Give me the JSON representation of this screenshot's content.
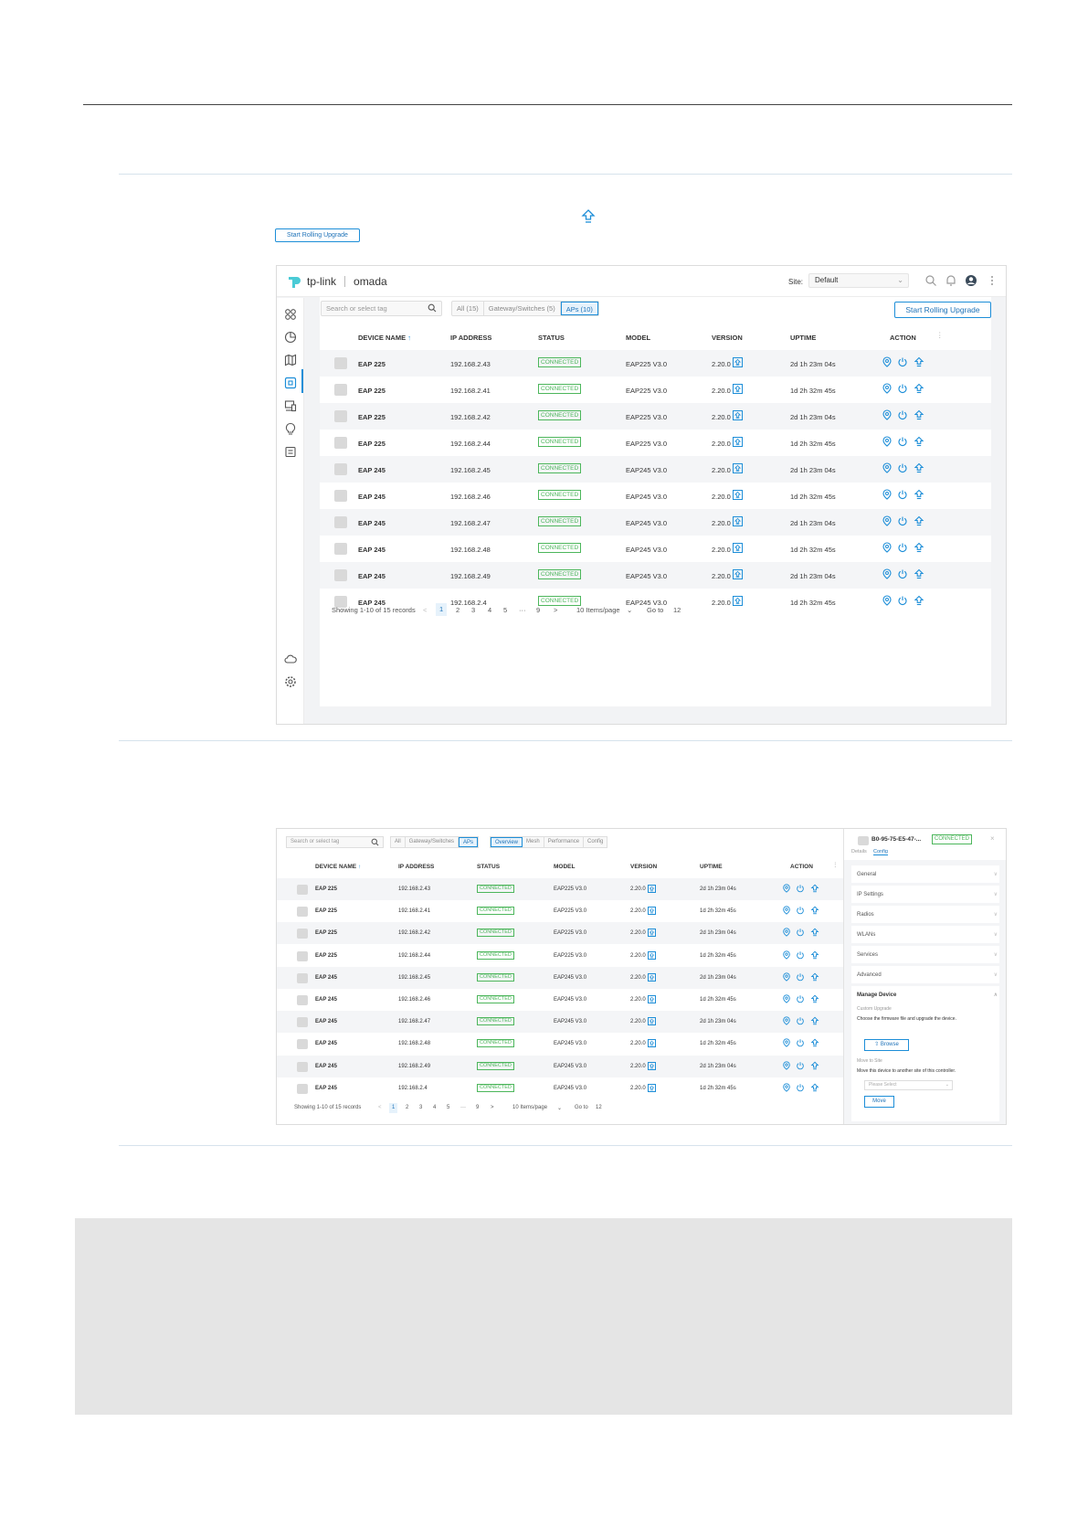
{
  "doc": {
    "button_label": "Start Rolling Upgrade"
  },
  "shot1": {
    "brand": "tp-link",
    "product": "omada",
    "site_label": "Site:",
    "site_value": "Default",
    "search_placeholder": "Search or select tag",
    "tabs": [
      "All (15)",
      "Gateway/Switches (5)",
      "APs (10)"
    ],
    "active_tab": "APs (10)",
    "rolling_button": "Start Rolling Upgrade",
    "columns": [
      "DEVICE NAME",
      "IP ADDRESS",
      "STATUS",
      "MODEL",
      "VERSION",
      "UPTIME",
      "ACTION"
    ],
    "sort_indicator": "↑",
    "rows": [
      {
        "name": "EAP 225",
        "ip": "192.168.2.43",
        "status": "CONNECTED",
        "model": "EAP225 V3.0",
        "version": "2.20.0",
        "uptime": "2d 1h 23m 04s"
      },
      {
        "name": "EAP 225",
        "ip": "192.168.2.41",
        "status": "CONNECTED",
        "model": "EAP225 V3.0",
        "version": "2.20.0",
        "uptime": "1d 2h 32m 45s"
      },
      {
        "name": "EAP 225",
        "ip": "192.168.2.42",
        "status": "CONNECTED",
        "model": "EAP225 V3.0",
        "version": "2.20.0",
        "uptime": "2d 1h 23m 04s"
      },
      {
        "name": "EAP 225",
        "ip": "192.168.2.44",
        "status": "CONNECTED",
        "model": "EAP225 V3.0",
        "version": "2.20.0",
        "uptime": "1d 2h 32m 45s"
      },
      {
        "name": "EAP 245",
        "ip": "192.168.2.45",
        "status": "CONNECTED",
        "model": "EAP245 V3.0",
        "version": "2.20.0",
        "uptime": "2d 1h 23m 04s"
      },
      {
        "name": "EAP 245",
        "ip": "192.168.2.46",
        "status": "CONNECTED",
        "model": "EAP245 V3.0",
        "version": "2.20.0",
        "uptime": "1d 2h 32m 45s"
      },
      {
        "name": "EAP 245",
        "ip": "192.168.2.47",
        "status": "CONNECTED",
        "model": "EAP245 V3.0",
        "version": "2.20.0",
        "uptime": "2d 1h 23m 04s"
      },
      {
        "name": "EAP 245",
        "ip": "192.168.2.48",
        "status": "CONNECTED",
        "model": "EAP245 V3.0",
        "version": "2.20.0",
        "uptime": "1d 2h 32m 45s"
      },
      {
        "name": "EAP 245",
        "ip": "192.168.2.49",
        "status": "CONNECTED",
        "model": "EAP245 V3.0",
        "version": "2.20.0",
        "uptime": "2d 1h 23m 04s"
      },
      {
        "name": "EAP 245",
        "ip": "192.168.2.4",
        "status": "CONNECTED",
        "model": "EAP245 V3.0",
        "version": "2.20.0",
        "uptime": "1d 2h 32m 45s"
      }
    ],
    "pager": {
      "showing": "Showing 1-10 of 15 records",
      "prev": "<",
      "pages": [
        "1",
        "2",
        "3",
        "4",
        "5",
        "···",
        "9"
      ],
      "current": "1",
      "next": ">",
      "per_page": "10 Items/page",
      "goto_label": "Go to",
      "goto_value": "12"
    }
  },
  "shot2": {
    "search_placeholder": "Search or select tag",
    "tabs": [
      "All",
      "Gateway/Switches",
      "APs"
    ],
    "active_tab": "APs",
    "view_tabs": [
      "Overview",
      "Mesh",
      "Performance",
      "Config"
    ],
    "active_view_tab": "Overview",
    "columns": [
      "DEVICE NAME",
      "IP ADDRESS",
      "STATUS",
      "MODEL",
      "VERSION",
      "UPTIME",
      "ACTION"
    ],
    "sort_indicator": "↑",
    "rows": [
      {
        "name": "EAP 225",
        "ip": "192.168.2.43",
        "status": "CONNECTED",
        "model": "EAP225 V3.0",
        "version": "2.20.0",
        "uptime": "2d 1h 23m 04s"
      },
      {
        "name": "EAP 225",
        "ip": "192.168.2.41",
        "status": "CONNECTED",
        "model": "EAP225 V3.0",
        "version": "2.20.0",
        "uptime": "1d 2h 32m 45s"
      },
      {
        "name": "EAP 225",
        "ip": "192.168.2.42",
        "status": "CONNECTED",
        "model": "EAP225 V3.0",
        "version": "2.20.0",
        "uptime": "2d 1h 23m 04s"
      },
      {
        "name": "EAP 225",
        "ip": "192.168.2.44",
        "status": "CONNECTED",
        "model": "EAP225 V3.0",
        "version": "2.20.0",
        "uptime": "1d 2h 32m 45s"
      },
      {
        "name": "EAP 245",
        "ip": "192.168.2.45",
        "status": "CONNECTED",
        "model": "EAP245 V3.0",
        "version": "2.20.0",
        "uptime": "2d 1h 23m 04s"
      },
      {
        "name": "EAP 245",
        "ip": "192.168.2.46",
        "status": "CONNECTED",
        "model": "EAP245 V3.0",
        "version": "2.20.0",
        "uptime": "1d 2h 32m 45s"
      },
      {
        "name": "EAP 245",
        "ip": "192.168.2.47",
        "status": "CONNECTED",
        "model": "EAP245 V3.0",
        "version": "2.20.0",
        "uptime": "2d 1h 23m 04s"
      },
      {
        "name": "EAP 245",
        "ip": "192.168.2.48",
        "status": "CONNECTED",
        "model": "EAP245 V3.0",
        "version": "2.20.0",
        "uptime": "1d 2h 32m 45s"
      },
      {
        "name": "EAP 245",
        "ip": "192.168.2.49",
        "status": "CONNECTED",
        "model": "EAP245 V3.0",
        "version": "2.20.0",
        "uptime": "2d 1h 23m 04s"
      },
      {
        "name": "EAP 245",
        "ip": "192.168.2.4",
        "status": "CONNECTED",
        "model": "EAP245 V3.0",
        "version": "2.20.0",
        "uptime": "1d 2h 32m 45s"
      }
    ],
    "pager": {
      "showing": "Showing 1-10 of 15 records",
      "prev": "<",
      "pages": [
        "1",
        "2",
        "3",
        "4",
        "5",
        "···",
        "9"
      ],
      "current": "1",
      "next": ">",
      "per_page": "10 Items/page",
      "goto_label": "Go to",
      "goto_value": "12"
    },
    "panel": {
      "mac": "B0-95-75-E5-47-...",
      "status": "CONNECTED",
      "close": "×",
      "tab_details": "Details",
      "tab_config": "Config",
      "sections": [
        "General",
        "IP Settings",
        "Radios",
        "WLANs",
        "Services",
        "Advanced"
      ],
      "manage_title": "Manage Device",
      "custom_upgrade": "Custom Upgrade",
      "upgrade_desc": "Choose the firmware file and upgrade the device.",
      "browse": "Browse",
      "move_to_site": "Move to Site",
      "move_desc": "Move this device to another site of this controller.",
      "select_placeholder": "Please Select",
      "move_button": "Move"
    }
  },
  "colors": {
    "accent": "#1d8ed8",
    "connected": "#4cb65b",
    "gray_box": "#e5e5e5"
  }
}
